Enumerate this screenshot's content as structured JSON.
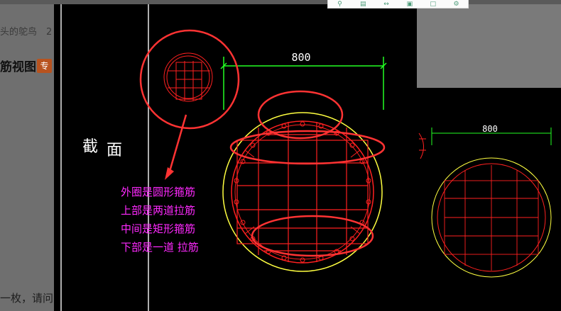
{
  "background_page": {
    "author_text": "头的鸵鸟　2",
    "heading": "筋视图",
    "badge": "专",
    "bottom_text": "一枚，请问"
  },
  "toolbar": {
    "icons": [
      "search-icon",
      "document-icon",
      "expand-icon",
      "save-icon",
      "window-icon",
      "settings-icon"
    ]
  },
  "cad_drawing": {
    "dimension_main": "800",
    "dimension_right": "800",
    "section_label": [
      "截",
      "面"
    ],
    "annotation_lines": [
      "外圈是圆形箍筋",
      "上部是两道拉筋",
      "中间是矩形箍筋",
      "下部是一道 拉筋"
    ],
    "colors": {
      "background": "#000000",
      "rebar": "#ff2020",
      "outline": "#ffff40",
      "dimension": "#20ff20",
      "annotation_text": "#ff29ff",
      "markup": "#ff3030"
    }
  }
}
